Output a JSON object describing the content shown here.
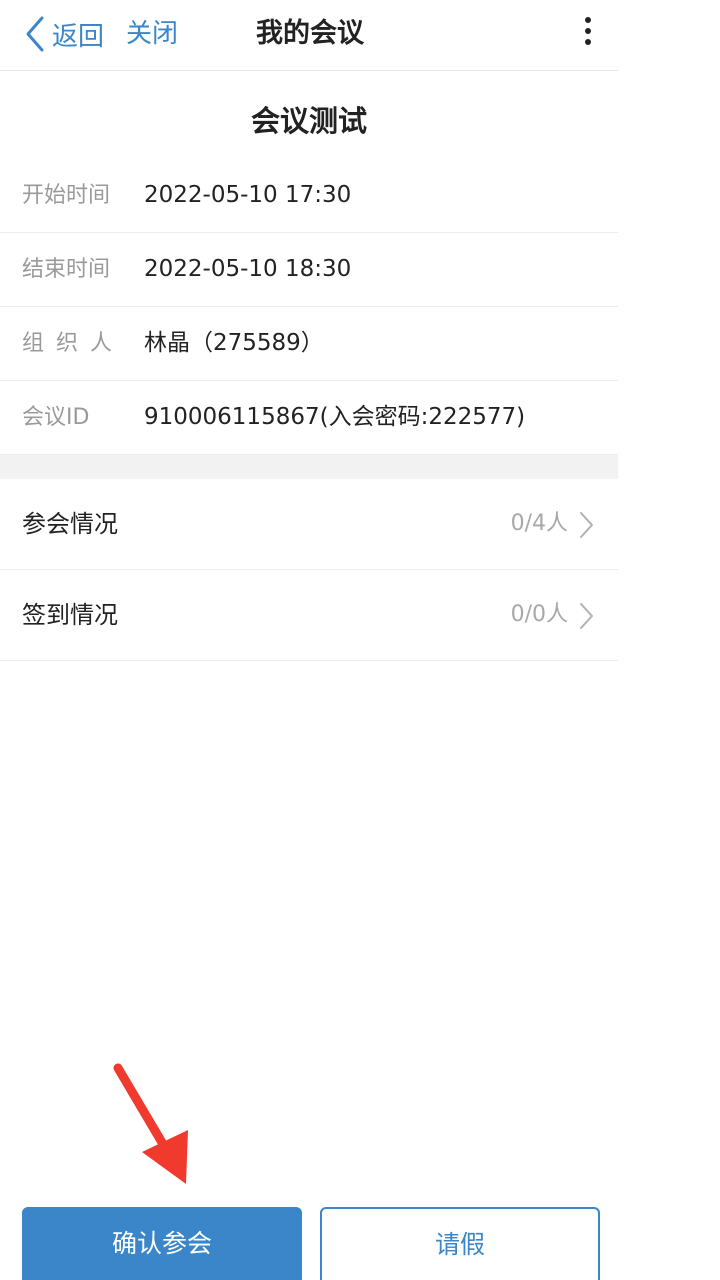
{
  "nav": {
    "back_label": "返回",
    "close_label": "关闭",
    "title": "我的会议"
  },
  "meeting": {
    "title": "会议测试",
    "fields": [
      {
        "label": "开始时间",
        "value": "2022-05-10 17:30"
      },
      {
        "label": "结束时间",
        "value": "2022-05-10 18:30"
      },
      {
        "label": "组织人",
        "value": "林晶（275589）"
      },
      {
        "label": "会议ID",
        "value": "910006115867(入会密码:222577)"
      }
    ]
  },
  "status": [
    {
      "label": "参会情况",
      "count": "0/4人"
    },
    {
      "label": "签到情况",
      "count": "0/0人"
    }
  ],
  "actions": {
    "confirm_label": "确认参会",
    "leave_label": "请假"
  },
  "colors": {
    "accent": "#3a86c8",
    "annotation": "#f03a2e"
  },
  "icons": {
    "back": "chevron-left-icon",
    "more": "more-vertical-icon",
    "row": "chevron-right-icon",
    "annotation": "red-arrow-annotation"
  }
}
